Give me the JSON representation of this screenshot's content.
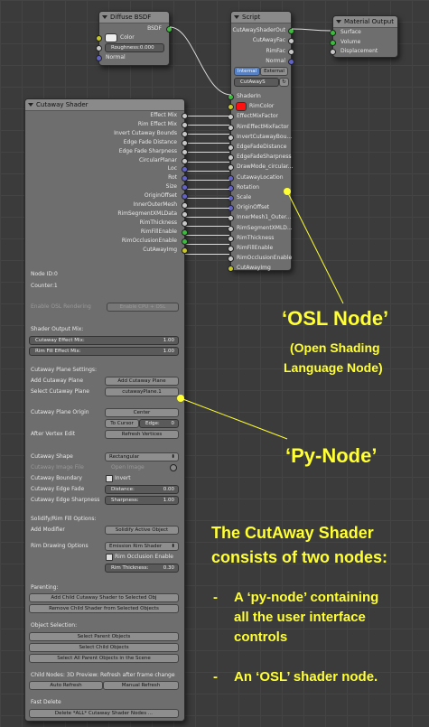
{
  "diffuse": {
    "title": "Diffuse BSDF",
    "out_bsdf": "BSDF",
    "color": "Color",
    "roughness": "Roughness:0.000",
    "normal": "Normal"
  },
  "script": {
    "title": "Script",
    "outputs": [
      "CutAwayShaderOut",
      "CutAwayFac",
      "RimFac",
      "Normal"
    ],
    "tab_internal": "Internal",
    "tab_external": "External",
    "script_name": "CutAwayS",
    "inputs": [
      "ShaderIn",
      "RimColor",
      "EffectMixFactor",
      "RimEffectMixFactor",
      "InvertCutawayBou...",
      "EdgeFadeDistance",
      "EdgeFadeSharpness",
      "DrawMode_circular...",
      "CutawayLocation",
      "Rotation",
      "Scale",
      "OriginOffset",
      "InnerMesh1_Outer...",
      "RimSegmentXMLD...",
      "RimThickness",
      "RimFillEnable",
      "RimOcclusionEnable",
      "CutAwayImg"
    ]
  },
  "material_output": {
    "title": "Material Output",
    "inputs": [
      "Surface",
      "Volume",
      "Displacement"
    ]
  },
  "cutaway": {
    "title": "Cutaway Shader",
    "outputs": [
      "Effect Mix",
      "Rim Effect Mix",
      "Invert Cutaway Bounds",
      "Edge Fade Distance",
      "Edge Fade Sharpness",
      "CircularPlanar",
      "Loc",
      "Rot",
      "Size",
      "OriginOffset",
      "InnerOuterMesh",
      "RimSegmentXMLData",
      "RimThickness",
      "RimFillEnable",
      "RimOcclusionEnable",
      "CutAwayImg"
    ],
    "node_id": "Node ID:0",
    "counter": "Counter:1",
    "enable_osl": "Enable OSL Rendering",
    "enable_cpu": "Enable CPU + OSL",
    "shader_output_mix": "Shader Output Mix:",
    "cutaway_effect_mix": "Cutaway Effect Mix:",
    "cutaway_effect_val": "1.00",
    "rim_fill_mix": "Rim Fill Effect Mix:",
    "rim_fill_val": "1.00",
    "plane_settings": "Cutaway Plane Settings:",
    "add_plane_lbl": "Add Cutaway Plane",
    "add_plane_btn": "Add Cutaway Plane",
    "select_plane_lbl": "Select Cutaway Plane",
    "select_plane_val": "cutawayPlane.1",
    "plane_origin_lbl": "Cutaway Plane Origin",
    "center_btn": "Center",
    "to_cursor_btn": "To Cursor",
    "edge_lbl": "Edge:",
    "edge_val": "0",
    "after_vertex_lbl": "After Vertex Edit",
    "refresh_vertices_btn": "Refresh Vertices",
    "shape_lbl": "Cutaway Shape",
    "shape_val": "Rectangular",
    "image_file_lbl": "Cutaway Image File",
    "open_image": "Open Image",
    "boundary_lbl": "Cutaway Boundary",
    "invert_lbl": "Invert",
    "edge_fade_lbl": "Cutaway Edge Fade",
    "distance_lbl": "Distance:",
    "distance_val": "0.00",
    "edge_sharp_lbl": "Cutaway Edge Sharpness",
    "sharpness_lbl": "Sharpness:",
    "sharpness_val": "1.00",
    "solidify_opts": "Solidify/Rim Fill Options:",
    "add_modifier_lbl": "Add Modifier",
    "solidify_btn": "Solidify Active Object",
    "rim_drawing_lbl": "Rim Drawing Options",
    "rim_drawing_val": "Emission Rim Shader",
    "rim_occ_lbl": "Rim Occlusion Enable",
    "rim_thick_lbl": "Rim Thickness:",
    "rim_thick_val": "0.30",
    "parenting": "Parenting:",
    "add_child_btn": "Add Child Cutaway Shader to Selected Obj",
    "remove_child_btn": "Remove Child Shader from Selected Objects",
    "object_selection": "Object Selection:",
    "select_parent_btn": "Select Parent Objects",
    "select_child_btn": "Select Child Objects",
    "select_all_parent_btn": "Select All Parent Objects in the Scene",
    "child_nodes": "Child Nodes: 3D Preview: Refresh after frame change",
    "auto_refresh": "Auto Refresh",
    "manual_refresh": "Manual Refresh",
    "fast_delete": "Fast Delete",
    "delete_all_btn": "Delete *ALL* Cutaway Shader Nodes ..."
  },
  "annotations": {
    "osl_title": "‘OSL Node’",
    "osl_sub1": "(Open Shading",
    "osl_sub2": "Language Node)",
    "py_title": "‘Py-Node’",
    "summary1": "The CutAway Shader",
    "summary2": "consists of two nodes:",
    "bullet1a": "A ‘py-node’ containing",
    "bullet1b": "all the user interface",
    "bullet1c": "controls",
    "bullet2": "An ‘OSL’ shader node.",
    "dash": "-"
  },
  "colors": {
    "rim_color": "#ff1111",
    "annotation": "#ffff33"
  }
}
